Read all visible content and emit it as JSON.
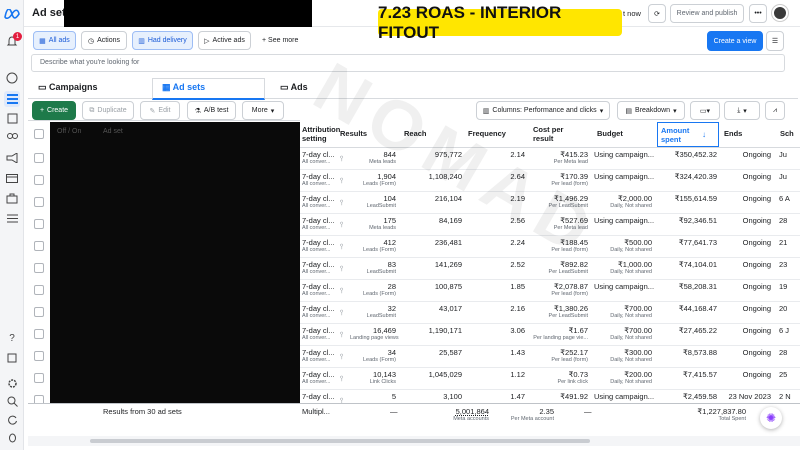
{
  "header": {
    "page_title": "Ad sets",
    "time_text": "t now",
    "review_publish": "Review and publish",
    "more_dots": "•••",
    "banner": "7.23 ROAS - INTERIOR FITOUT",
    "notification_count": "1"
  },
  "filters": {
    "all_ads": "All ads",
    "actions": "Actions",
    "had_delivery": "Had delivery",
    "active_ads": "Active ads",
    "see_more": "See more",
    "create_view": "Create a view",
    "search_placeholder": "Describe what you're looking for"
  },
  "tabs": {
    "campaigns": "Campaigns",
    "adsets": "Ad sets",
    "ads": "Ads"
  },
  "toolbar": {
    "create": "Create",
    "duplicate": "Duplicate",
    "edit": "Edit",
    "ab_test": "A/B test",
    "more": "More",
    "columns": "Columns: Performance and clicks",
    "breakdown": "Breakdown"
  },
  "table": {
    "headers": {
      "offon": "Off / On",
      "adset": "Ad set",
      "attribution": "Attribution setting",
      "results": "Results",
      "reach": "Reach",
      "frequency": "Frequency",
      "cost": "Cost per result",
      "budget": "Budget",
      "amount": "Amount spent",
      "ends": "Ends",
      "sch": "Sch"
    },
    "rows": [
      {
        "attr": "7-day cl...",
        "attr_sub": "All conver...",
        "res": "844",
        "res_sub": "Meta leads",
        "reach": "975,772",
        "freq": "2.14",
        "cost": "₹415.23",
        "cost_sub": "Per Meta lead",
        "budget": "Using campaign...",
        "budget_sub": "",
        "amount": "₹350,452.32",
        "ends": "Ongoing",
        "sch": "Ju"
      },
      {
        "attr": "7-day cl...",
        "attr_sub": "All conver...",
        "res": "1,904",
        "res_sub": "Leads (Form)",
        "reach": "1,108,240",
        "freq": "2.64",
        "cost": "₹170.39",
        "cost_sub": "Per lead (form)",
        "budget": "Using campaign...",
        "budget_sub": "",
        "amount": "₹324,420.39",
        "ends": "Ongoing",
        "sch": "Ju"
      },
      {
        "attr": "7-day cl...",
        "attr_sub": "All conver...",
        "res": "104",
        "res_sub": "LeadSubmit",
        "reach": "216,104",
        "freq": "2.19",
        "cost": "₹1,496.29",
        "cost_sub": "Per LeadSubmit",
        "budget": "₹2,000.00",
        "budget_sub": "Daily, Not shared",
        "amount": "₹155,614.59",
        "ends": "Ongoing",
        "sch": "6 A"
      },
      {
        "attr": "7-day cl...",
        "attr_sub": "All conver...",
        "res": "175",
        "res_sub": "Meta leads",
        "reach": "84,169",
        "freq": "2.56",
        "cost": "₹527.69",
        "cost_sub": "Per Meta lead",
        "budget": "Using campaign...",
        "budget_sub": "",
        "amount": "₹92,346.51",
        "ends": "Ongoing",
        "sch": "28"
      },
      {
        "attr": "7-day cl...",
        "attr_sub": "All conver...",
        "res": "412",
        "res_sub": "Leads (Form)",
        "reach": "236,481",
        "freq": "2.24",
        "cost": "₹188.45",
        "cost_sub": "Per lead (form)",
        "budget": "₹500.00",
        "budget_sub": "Daily, Not shared",
        "amount": "₹77,641.73",
        "ends": "Ongoing",
        "sch": "21"
      },
      {
        "attr": "7-day cl...",
        "attr_sub": "All conver...",
        "res": "83",
        "res_sub": "LeadSubmit",
        "reach": "141,269",
        "freq": "2.52",
        "cost": "₹892.82",
        "cost_sub": "Per LeadSubmit",
        "budget": "₹1,000.00",
        "budget_sub": "Daily, Not shared",
        "amount": "₹74,104.01",
        "ends": "Ongoing",
        "sch": "23"
      },
      {
        "attr": "7-day cl...",
        "attr_sub": "All conver...",
        "res": "28",
        "res_sub": "Leads (Form)",
        "reach": "100,875",
        "freq": "1.85",
        "cost": "₹2,078.87",
        "cost_sub": "Per lead (form)",
        "budget": "Using campaign...",
        "budget_sub": "",
        "amount": "₹58,208.31",
        "ends": "Ongoing",
        "sch": "19"
      },
      {
        "attr": "7-day cl...",
        "attr_sub": "All conver...",
        "res": "32",
        "res_sub": "LeadSubmit",
        "reach": "43,017",
        "freq": "2.16",
        "cost": "₹1,380.26",
        "cost_sub": "Per LeadSubmit",
        "budget": "₹700.00",
        "budget_sub": "Daily, Not shared",
        "amount": "₹44,168.47",
        "ends": "Ongoing",
        "sch": "20"
      },
      {
        "attr": "7-day cl...",
        "attr_sub": "All conver...",
        "res": "16,469",
        "res_sub": "Landing page views",
        "reach": "1,190,171",
        "freq": "3.06",
        "cost": "₹1.67",
        "cost_sub": "Per landing page vie...",
        "budget": "₹700.00",
        "budget_sub": "Daily, Not shared",
        "amount": "₹27,465.22",
        "ends": "Ongoing",
        "sch": "6 J"
      },
      {
        "attr": "7-day cl...",
        "attr_sub": "All conver...",
        "res": "34",
        "res_sub": "Leads (Form)",
        "reach": "25,587",
        "freq": "1.43",
        "cost": "₹252.17",
        "cost_sub": "Per lead (form)",
        "budget": "₹300.00",
        "budget_sub": "Daily, Not shared",
        "amount": "₹8,573.88",
        "ends": "Ongoing",
        "sch": "28"
      },
      {
        "attr": "7-day cl...",
        "attr_sub": "All conver...",
        "res": "10,143",
        "res_sub": "Link Clicks",
        "reach": "1,045,029",
        "freq": "1.12",
        "cost": "₹0.73",
        "cost_sub": "Per link click",
        "budget": "₹200.00",
        "budget_sub": "Daily, Not shared",
        "amount": "₹7,415.57",
        "ends": "Ongoing",
        "sch": "25"
      },
      {
        "attr": "7-day cl...",
        "attr_sub": "",
        "res": "5",
        "res_sub": "",
        "reach": "3,100",
        "freq": "1.47",
        "cost": "₹491.92",
        "cost_sub": "",
        "budget": "Using campaign...",
        "budget_sub": "",
        "amount": "₹2,459.58",
        "ends": "23 Nov 2023",
        "sch": "2 N"
      }
    ],
    "summary": {
      "label": "Results from 30 ad sets",
      "attr": "Multipl...",
      "res": "—",
      "reach": "5,001,864",
      "reach_sub": "Meta accounts",
      "freq": "2.35",
      "freq_sub": "Per Meta account",
      "cost": "—",
      "amount": "₹1,227,837.80",
      "amount_sub": "Total Spent"
    }
  },
  "watermark": "NOMAD",
  "colors": {
    "accent": "#1877f2",
    "create_green": "#1e7a4a",
    "banner_yellow": "#ffe600"
  }
}
